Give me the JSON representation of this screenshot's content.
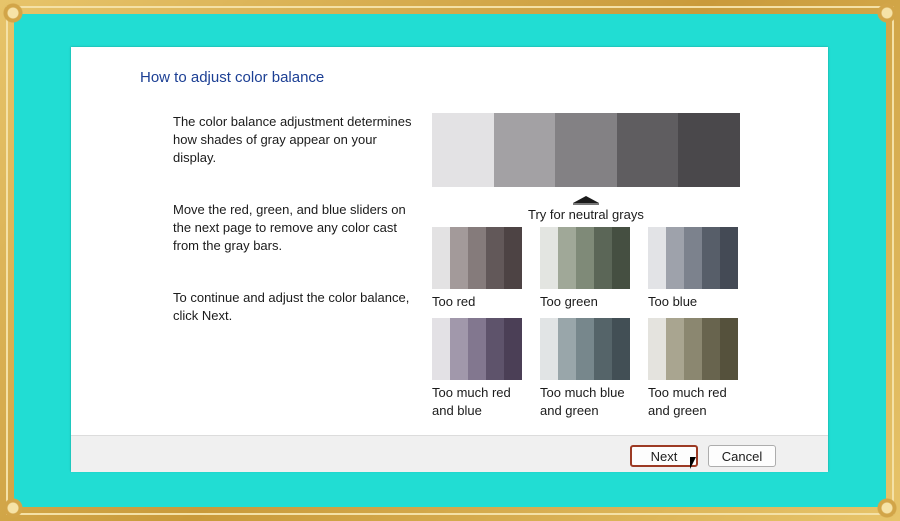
{
  "dialog": {
    "title": "How to adjust color balance",
    "paragraphs": [
      "The color balance adjustment determines how shades of gray appear on your display.",
      "Move the red, green, and blue sliders on the next page to remove any color cast from the gray bars.",
      "To continue and adjust the color balance, click Next."
    ],
    "neutral_bar_colors": [
      "#e3e2e4",
      "#a3a1a4",
      "#838184",
      "#5f5d60",
      "#4a484b"
    ],
    "caption": "Try for neutral grays",
    "examples": [
      {
        "label": "Too red",
        "colors": [
          "#e3e2e3",
          "#a39a9a",
          "#857b7b",
          "#625859",
          "#4d4344"
        ]
      },
      {
        "label": "Too green",
        "colors": [
          "#e3e5e1",
          "#a0a898",
          "#7f8a78",
          "#5b6657",
          "#454f41"
        ]
      },
      {
        "label": "Too blue",
        "colors": [
          "#e2e3e6",
          "#9ea2ab",
          "#7c828d",
          "#575e69",
          "#444a55"
        ]
      },
      {
        "label": "Too much red and blue",
        "colors": [
          "#e3e1e5",
          "#a198ab",
          "#82778f",
          "#5e536b",
          "#4b3f56"
        ]
      },
      {
        "label": "Too much blue and green",
        "colors": [
          "#e1e4e5",
          "#99a6aa",
          "#77878c",
          "#556469",
          "#424f55"
        ]
      },
      {
        "label": "Too much red and green",
        "colors": [
          "#e4e3de",
          "#a9a590",
          "#8b8770",
          "#68644e",
          "#55513c"
        ]
      }
    ],
    "buttons": {
      "next": "Next",
      "cancel": "Cancel"
    }
  }
}
